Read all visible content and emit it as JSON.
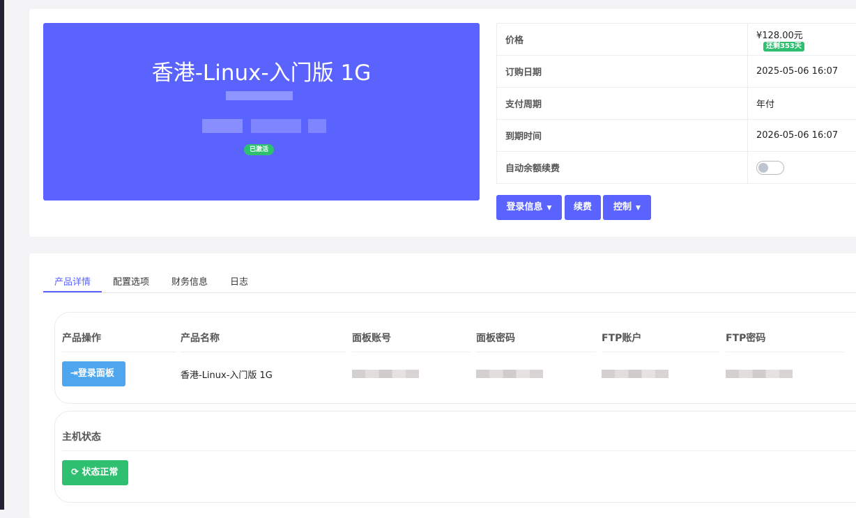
{
  "hero": {
    "title": "香港-Linux-入门版 1G",
    "status_badge": "已激活"
  },
  "info": {
    "rows": [
      {
        "label": "价格",
        "value": "¥128.00元",
        "badge": "还剩353天"
      },
      {
        "label": "订购日期",
        "value": "2025-05-06 16:07"
      },
      {
        "label": "支付周期",
        "value": "年付"
      },
      {
        "label": "到期时间",
        "value": "2026-05-06 16:07"
      },
      {
        "label": "自动余额续费",
        "toggle": false
      }
    ]
  },
  "actions": {
    "login_info": "登录信息",
    "renew": "续费",
    "control": "控制"
  },
  "tabs": [
    "产品详情",
    "配置选项",
    "财务信息",
    "日志"
  ],
  "product": {
    "headers": [
      "产品操作",
      "产品名称",
      "面板账号",
      "面板密码",
      "FTP账户",
      "FTP密码"
    ],
    "login_panel_button": "登录面板",
    "product_name": "香港-Linux-入门版 1G"
  },
  "host": {
    "title": "主机状态",
    "status_button": "状态正常"
  },
  "colors": {
    "primary": "#5b63fe",
    "success": "#2fbf71",
    "login_panel": "#4ea6ee"
  }
}
